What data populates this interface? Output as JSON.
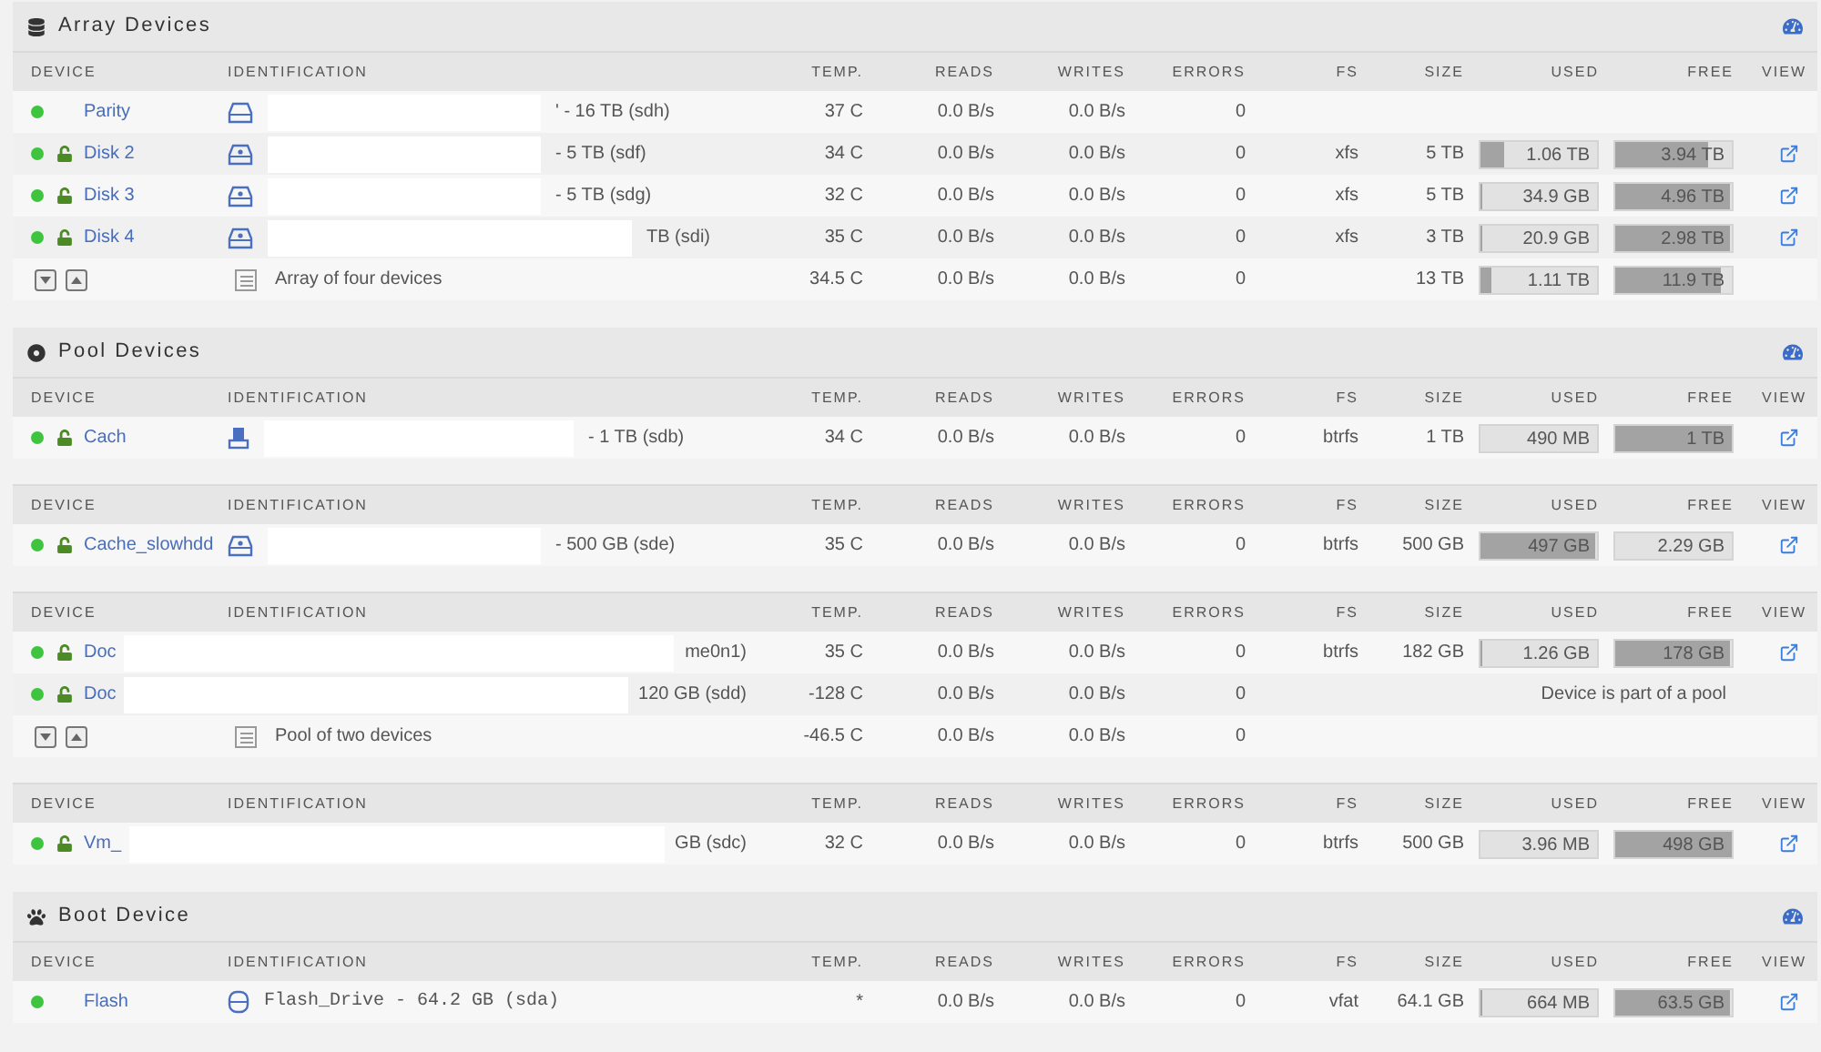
{
  "sections": [
    {
      "title": "Array Devices",
      "tables": [
        {
          "columns": [
            "DEVICE",
            "IDENTIFICATION",
            "TEMP.",
            "READS",
            "WRITES",
            "ERRORS",
            "FS",
            "SIZE",
            "USED",
            "FREE",
            "VIEW"
          ],
          "rows": [
            {
              "kind": "device",
              "color": "#3ec43e",
              "encrypted": false,
              "name": "Parity",
              "drive": {
                "kind": "hdd"
              },
              "redaction": {
                "kind": "id"
              },
              "id_text": "' - 16 TB (sdh)",
              "temp": "37 C",
              "reads": "0.0 B/s",
              "writes": "0.0 B/s",
              "errors": "0",
              "view": false
            },
            {
              "kind": "device",
              "color": "#3ec43e",
              "encrypted": true,
              "name": "Disk 2",
              "drive": {
                "kind": "disk"
              },
              "redaction": {
                "kind": "id"
              },
              "id_text": "- 5 TB (sdf)",
              "temp": "34 C",
              "reads": "0.0 B/s",
              "writes": "0.0 B/s",
              "errors": "0",
              "fs": "xfs",
              "size": "5 TB",
              "used": {
                "text": "1.06 TB",
                "level": 0.21
              },
              "free": {
                "text": "3.94 TB",
                "level": 0.79
              },
              "view": true
            },
            {
              "kind": "device",
              "color": "#3ec43e",
              "encrypted": true,
              "name": "Disk 3",
              "drive": {
                "kind": "disk"
              },
              "redaction": {
                "kind": "id"
              },
              "id_text": "- 5 TB (sdg)",
              "temp": "32 C",
              "reads": "0.0 B/s",
              "writes": "0.0 B/s",
              "errors": "0",
              "fs": "xfs",
              "size": "5 TB",
              "used": {
                "text": "34.9 GB",
                "level": 0.01
              },
              "free": {
                "text": "4.96 TB",
                "level": 0.99
              },
              "view": true
            },
            {
              "kind": "device",
              "color": "#3ec43e",
              "encrypted": true,
              "name": "Disk 4",
              "drive": {
                "kind": "disk"
              },
              "redaction": {
                "kind": "long"
              },
              "id_text": "TB (sdi)",
              "temp": "35 C",
              "reads": "0.0 B/s",
              "writes": "0.0 B/s",
              "errors": "0",
              "fs": "xfs",
              "size": "3 TB",
              "used": {
                "text": "20.9 GB",
                "level": 0.01
              },
              "free": {
                "text": "2.98 TB",
                "level": 0.99
              },
              "view": true
            },
            {
              "kind": "summary",
              "id_text": "Array of four devices",
              "temp": "34.5 C",
              "reads": "0.0 B/s",
              "writes": "0.0 B/s",
              "errors": "0",
              "size": "13 TB",
              "used": {
                "text": "1.11 TB",
                "level": 0.09
              },
              "free": {
                "text": "11.9 TB",
                "level": 0.91
              },
              "view": false
            }
          ]
        }
      ]
    },
    {
      "title": "Pool Devices",
      "tables": [
        {
          "columns": [
            "DEVICE",
            "IDENTIFICATION",
            "TEMP.",
            "READS",
            "WRITES",
            "ERRORS",
            "FS",
            "SIZE",
            "USED",
            "FREE",
            "VIEW"
          ],
          "rows": [
            {
              "kind": "device",
              "color": "#3ec43e",
              "encrypted": true,
              "name": "Cach",
              "drive": {
                "kind": "ssd"
              },
              "redaction": {
                "kind": "split"
              },
              "id_text": "- 1 TB (sdb)",
              "temp": "34 C",
              "reads": "0.0 B/s",
              "writes": "0.0 B/s",
              "errors": "0",
              "fs": "btrfs",
              "size": "1 TB",
              "used": {
                "text": "490 MB"
              },
              "free": {
                "text": "1 TB",
                "level": 1.0
              },
              "view": true
            }
          ]
        },
        {
          "columns": [
            "DEVICE",
            "IDENTIFICATION",
            "TEMP.",
            "READS",
            "WRITES",
            "ERRORS",
            "FS",
            "SIZE",
            "USED",
            "FREE",
            "VIEW"
          ],
          "rows": [
            {
              "kind": "device",
              "color": "#3ec43e",
              "encrypted": true,
              "name": "Cache_slowhdd",
              "drive": {
                "kind": "disk"
              },
              "redaction": {
                "kind": "id"
              },
              "id_text": "- 500 GB (sde)",
              "temp": "35 C",
              "reads": "0.0 B/s",
              "writes": "0.0 B/s",
              "errors": "0",
              "fs": "btrfs",
              "size": "500 GB",
              "used": {
                "text": "497 GB",
                "level": 0.99
              },
              "free": {
                "text": "2.29 GB"
              },
              "view": true
            }
          ]
        },
        {
          "columns": [
            "DEVICE",
            "IDENTIFICATION",
            "TEMP.",
            "READS",
            "WRITES",
            "ERRORS",
            "FS",
            "SIZE",
            "USED",
            "FREE",
            "VIEW"
          ],
          "rows": [
            {
              "kind": "device",
              "color": "#3ec43e",
              "encrypted": true,
              "name": "Doc",
              "redaction": {
                "kind": "across"
              },
              "id_text": "me0n1)",
              "temp": "35 C",
              "reads": "0.0 B/s",
              "writes": "0.0 B/s",
              "errors": "0",
              "fs": "btrfs",
              "size": "182 GB",
              "used": {
                "text": "1.26 GB",
                "level": 0.01
              },
              "free": {
                "text": "178 GB",
                "level": 0.98
              },
              "view": true
            },
            {
              "kind": "member",
              "color": "#3ec43e",
              "encrypted": true,
              "name": "Doc",
              "redaction": {
                "kind": "across"
              },
              "id_text": "120 GB (sdd)",
              "temp": "-128 C",
              "reads": "0.0 B/s",
              "writes": "0.0 B/s",
              "errors": "0",
              "note": "Device is part of a pool"
            },
            {
              "kind": "summary",
              "id_text": "Pool of two devices",
              "temp": "-46.5 C",
              "reads": "0.0 B/s",
              "writes": "0.0 B/s",
              "errors": "0",
              "view": false
            }
          ]
        },
        {
          "columns": [
            "DEVICE",
            "IDENTIFICATION",
            "TEMP.",
            "READS",
            "WRITES",
            "ERRORS",
            "FS",
            "SIZE",
            "USED",
            "FREE",
            "VIEW"
          ],
          "rows": [
            {
              "kind": "device",
              "color": "#3ec43e",
              "encrypted": true,
              "name": "Vm_",
              "redaction": {
                "kind": "across"
              },
              "id_text": "GB (sdc)",
              "temp": "32 C",
              "reads": "0.0 B/s",
              "writes": "0.0 B/s",
              "errors": "0",
              "fs": "btrfs",
              "size": "500 GB",
              "used": {
                "text": "3.96 MB"
              },
              "free": {
                "text": "498 GB",
                "level": 1.0
              },
              "view": true
            }
          ]
        }
      ]
    },
    {
      "title": "Boot Device",
      "tables": [
        {
          "columns": [
            "DEVICE",
            "IDENTIFICATION",
            "TEMP.",
            "READS",
            "WRITES",
            "ERRORS",
            "FS",
            "SIZE",
            "USED",
            "FREE",
            "VIEW"
          ],
          "rows": [
            {
              "kind": "device",
              "color": "#3ec43e",
              "encrypted": false,
              "name": "Flash",
              "drive": {
                "kind": "usb"
              },
              "id_text": "Flash_Drive - 64.2 GB (sda)",
              "temp": "*",
              "reads": "0.0 B/s",
              "writes": "0.0 B/s",
              "errors": "0",
              "fs": "vfat",
              "size": "64.1 GB",
              "used": {
                "text": "664 MB",
                "level": 0.01
              },
              "free": {
                "text": "63.5 GB",
                "level": 0.99
              },
              "view": true
            }
          ]
        }
      ]
    }
  ]
}
